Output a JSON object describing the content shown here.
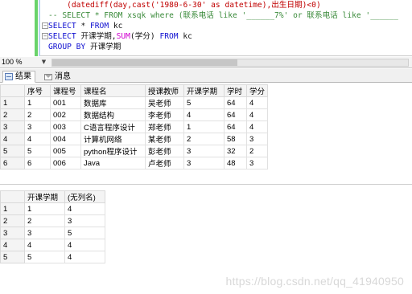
{
  "editor": {
    "lines": [
      [
        {
          "t": "    (datediff(day,cast('1980-6-30' as datetime),出生日期)<0)",
          "c": "c-str"
        }
      ],
      [
        {
          "t": "-- SELECT * FROM xsqk where (联系电话 like '______7%' or 联系电话 like '______",
          "c": "c-comment"
        }
      ],
      [
        {
          "t": "SELECT ",
          "c": "c-kw"
        },
        {
          "t": "* ",
          "c": "c-plain"
        },
        {
          "t": "FROM ",
          "c": "c-kw"
        },
        {
          "t": "kc",
          "c": "c-plain"
        }
      ],
      [
        {
          "t": "SELECT ",
          "c": "c-kw"
        },
        {
          "t": "开课学期,",
          "c": "c-plain"
        },
        {
          "t": "SUM",
          "c": "c-fn"
        },
        {
          "t": "(学分) ",
          "c": "c-plain"
        },
        {
          "t": "FROM ",
          "c": "c-kw"
        },
        {
          "t": "kc",
          "c": "c-plain"
        }
      ],
      [
        {
          "t": "GROUP BY ",
          "c": "c-kw"
        },
        {
          "t": "开课学期",
          "c": "c-plain"
        }
      ]
    ]
  },
  "zoom": {
    "value": "100 %"
  },
  "tabs": {
    "results": "结果",
    "messages": "消息"
  },
  "table1": {
    "headers": [
      "序号",
      "课程号",
      "课程名",
      "授课教师",
      "开课学期",
      "学时",
      "学分"
    ],
    "rows": [
      [
        "1",
        "1",
        "001",
        "数据库",
        "吴老师",
        "5",
        "64",
        "4"
      ],
      [
        "2",
        "2",
        "002",
        "数据结构",
        "李老师",
        "4",
        "64",
        "4"
      ],
      [
        "3",
        "3",
        "003",
        "C语言程序设计",
        "郑老师",
        "1",
        "64",
        "4"
      ],
      [
        "4",
        "4",
        "004",
        "计算机网络",
        "某老师",
        "2",
        "58",
        "3"
      ],
      [
        "5",
        "5",
        "005",
        "python程序设计",
        "彭老师",
        "3",
        "32",
        "2"
      ],
      [
        "6",
        "6",
        "006",
        "Java",
        "卢老师",
        "3",
        "48",
        "3"
      ]
    ]
  },
  "table2": {
    "headers": [
      "开课学期",
      "(无列名)"
    ],
    "rows": [
      [
        "1",
        "1",
        "4"
      ],
      [
        "2",
        "2",
        "3"
      ],
      [
        "3",
        "3",
        "5"
      ],
      [
        "4",
        "4",
        "4"
      ],
      [
        "5",
        "5",
        "4"
      ]
    ]
  },
  "watermark": "https://blog.csdn.net/qq_41940950"
}
